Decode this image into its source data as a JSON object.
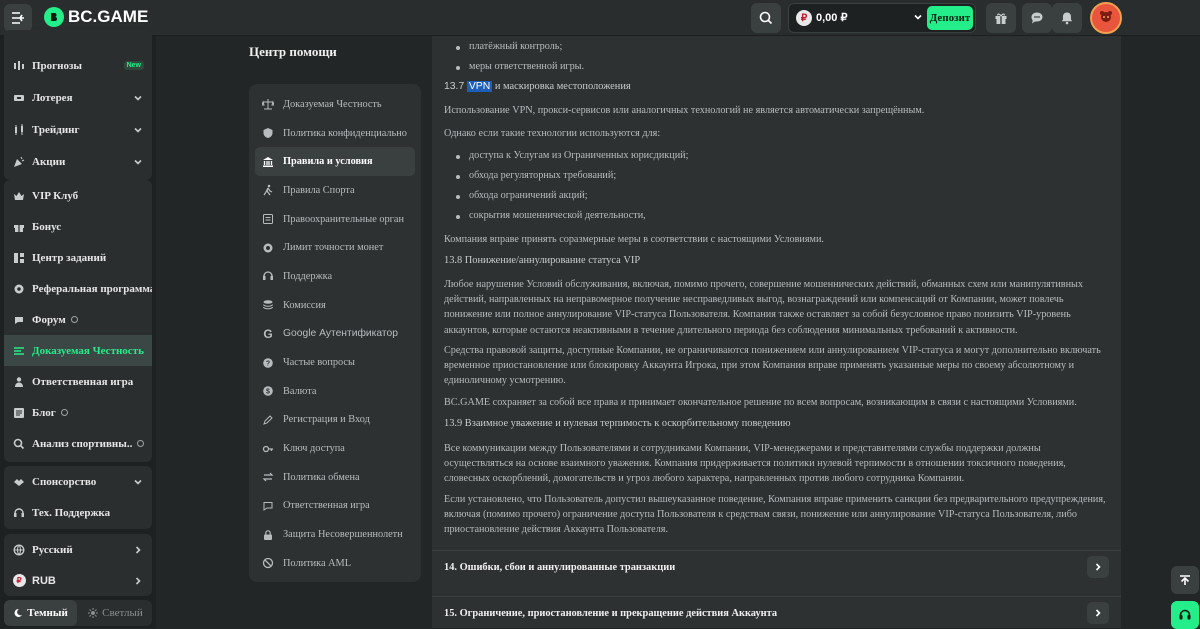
{
  "brand": {
    "name": "BC.GAME",
    "accent": "#24ee89"
  },
  "topbar": {
    "balance": "0,00 ₽",
    "currency_symbol": "₽",
    "deposit_label": "Депозит"
  },
  "sidebar": {
    "items": [
      {
        "label": "Прогнозы",
        "badge": "New"
      },
      {
        "label": "Лотерея"
      },
      {
        "label": "Трейдинг"
      },
      {
        "label": "Акции"
      },
      {
        "label": "VIP Клуб"
      },
      {
        "label": "Бонус"
      },
      {
        "label": "Центр заданий"
      },
      {
        "label": "Реферальная программа"
      },
      {
        "label": "Форум"
      },
      {
        "label": "Доказуемая Честность"
      },
      {
        "label": "Ответственная игра"
      },
      {
        "label": "Блог"
      },
      {
        "label": "Анализ спортивны..."
      },
      {
        "label": "Спонсорство"
      },
      {
        "label": "Тех. Поддержка"
      },
      {
        "label": "Русский"
      },
      {
        "label": "RUB"
      }
    ],
    "theme": {
      "dark": "Темный",
      "light": "Светлый"
    }
  },
  "help": {
    "title": "Центр помощи",
    "nav": [
      "Доказуемая Честность",
      "Политика конфиденциально",
      "Правила и условия",
      "Правила Спорта",
      "Правоохранительные орган",
      "Лимит точности монет",
      "Поддержка",
      "Комиссия",
      "Google Аутентификатор",
      "Частые вопросы",
      "Валюта",
      "Регистрация и Вход",
      "Ключ доступа",
      "Политика обмена",
      "Ответственная игра",
      "Защита Несовершеннолетн",
      "Политика AML"
    ]
  },
  "content": {
    "top_bullets": [
      "платёжный контроль;",
      "меры ответственной игры."
    ],
    "s137": {
      "num": "13.7",
      "vpn": "VPN",
      "rest": "и маскировка местоположения"
    },
    "s137_p1": "Использование VPN, прокси-сервисов или аналогичных технологий не является автоматически запрещённым.",
    "s137_p2": "Однако если такие технологии используются для:",
    "s137_bullets": [
      "доступа к Услугам из Ограниченных юрисдикций;",
      "обхода регуляторных требований;",
      "обхода ограничений акций;",
      "сокрытия мошеннической деятельности,"
    ],
    "s137_p3": "Компания вправе принять соразмерные меры в соответствии с настоящими Условиями.",
    "s138": "13.8 Понижение/аннулирование статуса VIP",
    "s138_p1": "Любое нарушение Условий обслуживания, включая, помимо прочего, совершение мошеннических действий, обманных схем или манипулятивных действий, направленных на неправомерное получение несправедливых выгод, вознаграждений или компенсаций от Компании, может повлечь понижение или полное аннулирование VIP-статуса Пользователя. Компания также оставляет за собой безусловное право понизить VIP-уровень аккаунтов, которые остаются неактивными в течение длительного периода без соблюдения минимальных требований к активности.",
    "s138_p2": "Средства правовой защиты, доступные Компании, не ограничиваются понижением или аннулированием VIP-статуса и могут дополнительно включать временное приостановление или блокировку Аккаунта Игрока, при этом Компания вправе применять указанные меры по своему абсолютному и единоличному усмотрению.",
    "s138_p3": "BC.GAME сохраняет за собой все права и принимает окончательное решение по всем вопросам, возникающим в связи с настоящими Условиями.",
    "s139": "13.9 Взаимное уважение и нулевая терпимость к оскорбительному поведению",
    "s139_p1": "Все коммуникации между Пользователями и сотрудниками Компании, VIP-менеджерами и представителями службы поддержки должны осуществляться на основе взаимного уважения. Компания придерживается политики нулевой терпимости в отношении токсичного поведения, словесных оскорблений, домогательств и угроз любого характера, направленных против любого сотрудника Компании.",
    "s139_p2": "Если установлено, что Пользователь допустил вышеуказанное поведение, Компания вправе применить санкции без предварительного предупреждения, включая (помимо прочего) ограничение доступа Пользователя к средствам связи, понижение или аннулирование VIP-статуса Пользователя, либо приостановление действия Аккаунта Пользователя.",
    "acc14": "14. Ошибки, сбои и аннулированные транзакции",
    "acc15": "15. Ограничение, приостановление и прекращение действия Аккаунта"
  }
}
